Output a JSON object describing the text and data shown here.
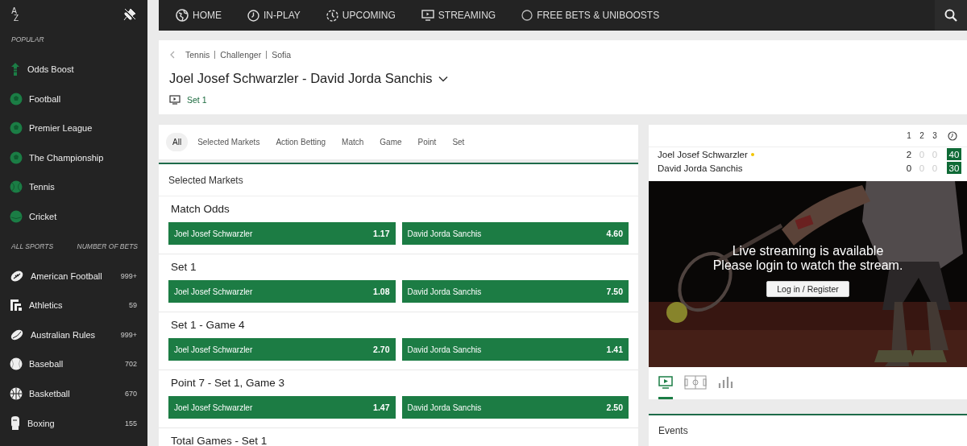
{
  "sidebar": {
    "sort_letters": [
      "A",
      "Z"
    ],
    "popular_heading": "POPULAR",
    "popular": [
      {
        "label": "Odds Boost",
        "kind": "boost"
      },
      {
        "label": "Football",
        "kind": "soccer"
      },
      {
        "label": "Premier League",
        "kind": "soccer"
      },
      {
        "label": "The Championship",
        "kind": "soccer"
      },
      {
        "label": "Tennis",
        "kind": "tennis"
      },
      {
        "label": "Cricket",
        "kind": "cricket"
      }
    ],
    "all_sports_heading": "ALL SPORTS",
    "bets_heading": "NUMBER OF BETS",
    "sports": [
      {
        "label": "American Football",
        "count": "999+",
        "kind": "american-football"
      },
      {
        "label": "Athletics",
        "count": "59",
        "kind": "athletics"
      },
      {
        "label": "Australian Rules",
        "count": "999+",
        "kind": "australian-rules"
      },
      {
        "label": "Baseball",
        "count": "702",
        "kind": "baseball"
      },
      {
        "label": "Basketball",
        "count": "670",
        "kind": "basketball"
      },
      {
        "label": "Boxing",
        "count": "155",
        "kind": "boxing"
      }
    ]
  },
  "nav": [
    {
      "label": "HOME",
      "kind": "home"
    },
    {
      "label": "IN-PLAY",
      "kind": "inplay"
    },
    {
      "label": "UPCOMING",
      "kind": "upcoming"
    },
    {
      "label": "STREAMING",
      "kind": "streaming"
    },
    {
      "label": "FREE BETS & UNIBOOSTS",
      "kind": "freebets"
    }
  ],
  "event": {
    "breadcrumb": [
      "Tennis",
      "Challenger",
      "Sofia"
    ],
    "title": "Joel Josef Schwarzler - David Jorda Sanchis",
    "status": "Set 1"
  },
  "filter_tabs": [
    {
      "label": "All",
      "selected": true
    },
    {
      "label": "Selected Markets",
      "selected": false
    },
    {
      "label": "Action Betting",
      "selected": false
    },
    {
      "label": "Match",
      "selected": false
    },
    {
      "label": "Game",
      "selected": false
    },
    {
      "label": "Point",
      "selected": false
    },
    {
      "label": "Set",
      "selected": false
    }
  ],
  "markets_heading": "Selected Markets",
  "markets": [
    {
      "name": "Match Odds",
      "outcomes": [
        {
          "name": "Joel Josef Schwarzler",
          "odds": "1.17"
        },
        {
          "name": "David Jorda Sanchis",
          "odds": "4.60"
        }
      ]
    },
    {
      "name": "Set 1",
      "outcomes": [
        {
          "name": "Joel Josef Schwarzler",
          "odds": "1.08"
        },
        {
          "name": "David Jorda Sanchis",
          "odds": "7.50"
        }
      ]
    },
    {
      "name": "Set 1 - Game 4",
      "outcomes": [
        {
          "name": "Joel Josef Schwarzler",
          "odds": "2.70"
        },
        {
          "name": "David Jorda Sanchis",
          "odds": "1.41"
        }
      ]
    },
    {
      "name": "Point 7 - Set 1, Game 3",
      "outcomes": [
        {
          "name": "Joel Josef Schwarzler",
          "odds": "1.47"
        },
        {
          "name": "David Jorda Sanchis",
          "odds": "2.50"
        }
      ]
    },
    {
      "name": "Total Games - Set 1"
    }
  ],
  "scoreboard": {
    "columns": [
      "1",
      "2",
      "3"
    ],
    "players": [
      {
        "name": "Joel Josef Schwarzler",
        "serving": true,
        "scores": [
          {
            "value": "2",
            "played": true
          },
          {
            "value": "0",
            "played": false
          },
          {
            "value": "0",
            "played": false
          }
        ],
        "points": "40"
      },
      {
        "name": "David Jorda Sanchis",
        "serving": false,
        "scores": [
          {
            "value": "0",
            "played": true
          },
          {
            "value": "0",
            "played": false
          },
          {
            "value": "0",
            "played": false
          }
        ],
        "points": "30"
      }
    ]
  },
  "stream": {
    "kind": "picture",
    "message": [
      "Live streaming is available",
      "Please login to watch the stream."
    ],
    "button": "Log in / Register"
  },
  "media_tabs": [
    {
      "kind": "video",
      "selected": true
    },
    {
      "kind": "pitch",
      "selected": false
    },
    {
      "kind": "stats",
      "selected": false
    }
  ],
  "events_heading": "Events"
}
